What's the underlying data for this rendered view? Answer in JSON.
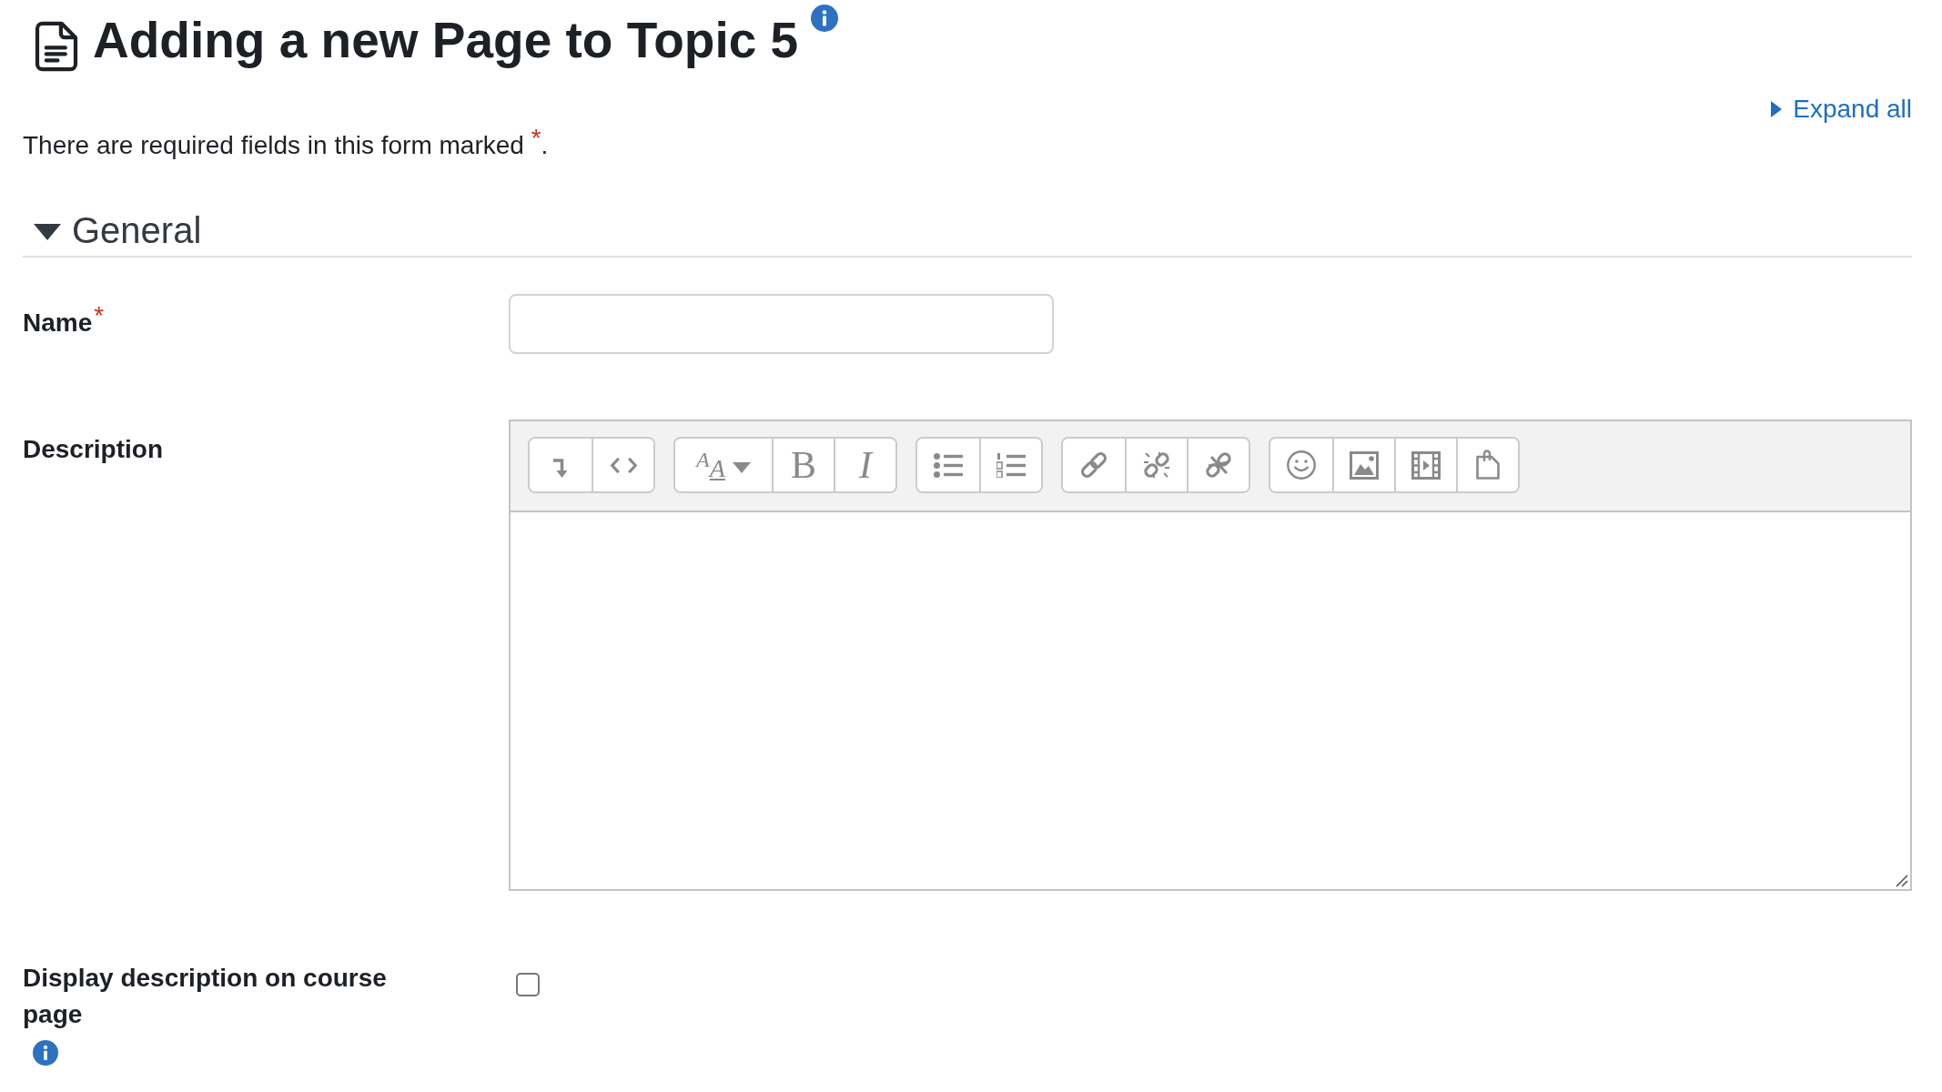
{
  "header": {
    "title": "Adding a new Page to Topic 5",
    "help": true
  },
  "expand_link": {
    "label": "Expand all"
  },
  "required_note": "There are required fields in this form marked $^{*}$.",
  "section": {
    "title": "General",
    "expanded": true
  },
  "fields": [
    {
      "kind": "text",
      "label": "Name",
      "required_mark": "*"
    },
    {
      "kind": "editor",
      "label": "Description",
      "toolbar": [
        [
          {
            "kind": "toggle"
          },
          {
            "kind": "html"
          }
        ],
        [
          {
            "kind": "style",
            "label": "AA"
          },
          {
            "kind": "bold",
            "label": "B"
          },
          {
            "kind": "italic",
            "label": "I"
          }
        ],
        [
          {
            "kind": "bullets"
          },
          {
            "kind": "numbers"
          }
        ],
        [
          {
            "kind": "link"
          },
          {
            "kind": "unlink"
          },
          {
            "kind": "noautolink"
          }
        ],
        [
          {
            "kind": "emoji"
          },
          {
            "kind": "image"
          },
          {
            "kind": "media"
          },
          {
            "kind": "files"
          }
        ]
      ]
    },
    {
      "kind": "checkbox",
      "label": "Display description on course page",
      "checked": false,
      "help": true
    }
  ]
}
